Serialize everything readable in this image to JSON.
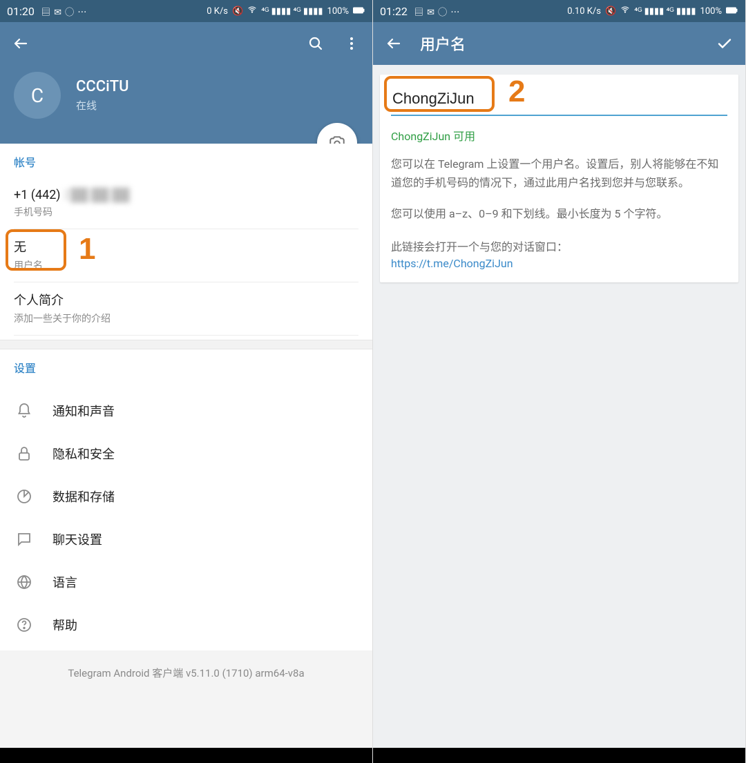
{
  "left": {
    "status": {
      "time": "01:20",
      "net": "0 K/s",
      "battery": "100%"
    },
    "profile": {
      "initial": "C",
      "name": "CCCiTU",
      "status": "在线"
    },
    "account": {
      "header": "帐号",
      "phone_prefix": "+1 (442) ",
      "phone_rest": "2",
      "phone_label": "手机号码",
      "username_value": "无",
      "username_label": "用户名",
      "bio_value": "个人简介",
      "bio_label": "添加一些关于你的介绍"
    },
    "settings": {
      "header": "设置",
      "items": [
        {
          "label": "通知和声音"
        },
        {
          "label": "隐私和安全"
        },
        {
          "label": "数据和存储"
        },
        {
          "label": "聊天设置"
        },
        {
          "label": "语言"
        },
        {
          "label": "帮助"
        }
      ]
    },
    "footer": "Telegram Android 客户端 v5.11.0 (1710) arm64-v8a",
    "anno": "1"
  },
  "right": {
    "status": {
      "time": "01:22",
      "net": "0.10 K/s",
      "battery": "100%"
    },
    "title": "用户名",
    "input_value": "ChongZiJun",
    "availability": "ChongZiJun 可用",
    "desc1": "您可以在 Telegram 上设置一个用户名。设置后，别人将能够在不知道您的手机号码的情况下，通过此用户名找到您并与您联系。",
    "desc2": "您可以使用 a–z、0–9 和下划线。最小长度为 5 个字符。",
    "link_label": "此链接会打开一个与您的对话窗口：",
    "link": "https://t.me/ChongZiJun",
    "anno": "2"
  }
}
